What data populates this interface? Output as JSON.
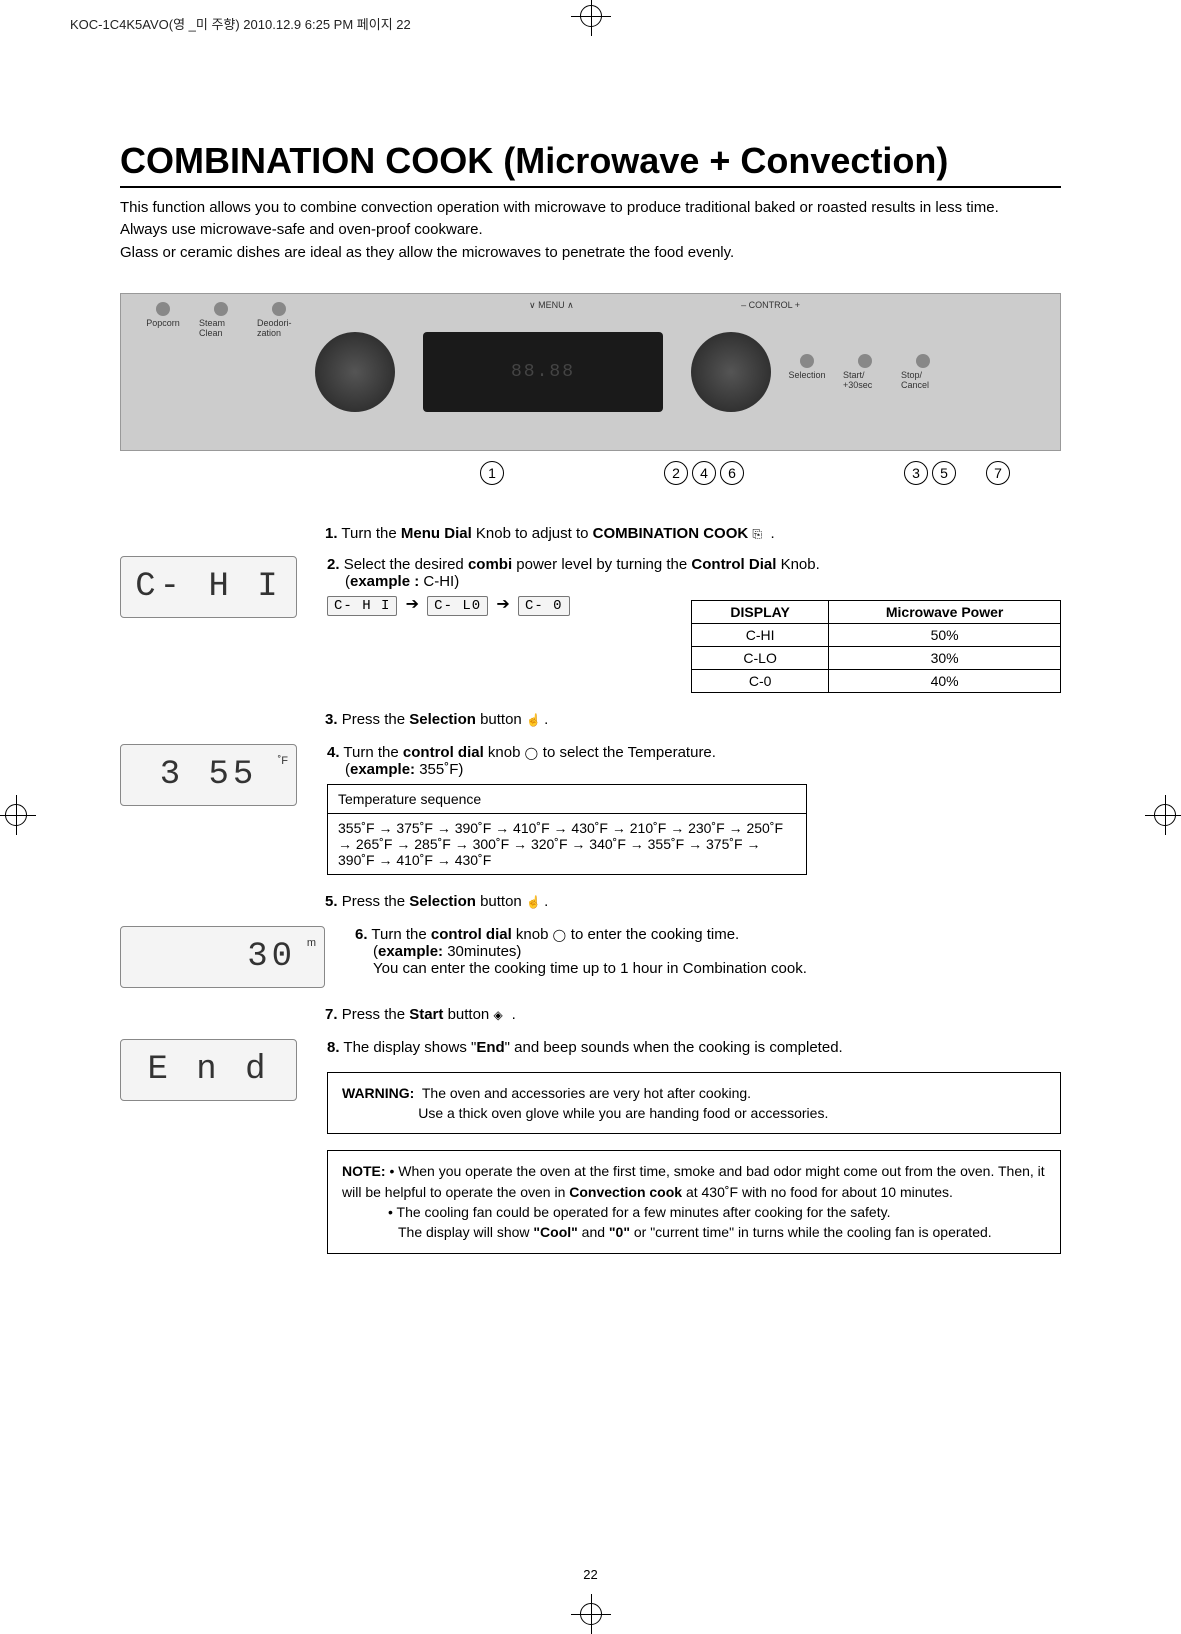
{
  "print_header": "KOC-1C4K5AVO(영 _미 주향) 2010.12.9 6:25 PM 페이지 22",
  "title": "COMBINATION COOK (Microwave + Convection)",
  "intro": [
    "This function allows you to combine convection operation with microwave to produce traditional baked or roasted results in less time.",
    "Always use microwave-safe and oven-proof cookware.",
    "Glass or ceramic dishes are ideal as they allow the microwaves to penetrate the food evenly."
  ],
  "panel": {
    "buttons_left": [
      "Popcorn",
      "Steam\nClean",
      "Deodori-\nzation"
    ],
    "menu_chevrons": "∨ MENU ∧",
    "display_digits": "88.88",
    "control_chevrons": "– CONTROL +",
    "buttons_right": [
      "Selection",
      "Start/\n+30sec",
      "Stop/\nCancel"
    ]
  },
  "step_circle_groups": [
    [
      "1"
    ],
    [
      "2",
      "4",
      "6"
    ],
    [
      "3",
      "5"
    ],
    [
      "7"
    ]
  ],
  "displays": {
    "d1": "C- H I",
    "d2": "3 55",
    "d2_unit": "˚F",
    "d3": "30",
    "d3_unit": "m",
    "d4": "E n d"
  },
  "small_displays": [
    "C- H I",
    "C- L0",
    "C- 0"
  ],
  "steps": {
    "s1_pre": "Turn the ",
    "s1_bold1": "Menu Dial",
    "s1_mid": " Knob to adjust to ",
    "s1_bold2": "COMBINATION COOK",
    "s1_icon_label": "combi-icon",
    "s2_a": "Select the desired ",
    "s2_b": "combi",
    "s2_c": " power level by turning the ",
    "s2_d": "Control Dial",
    "s2_e": " Knob.",
    "s2_example_label": "example :",
    "s2_example_val": " C-HI",
    "s3_a": "Press the ",
    "s3_b": "Selection",
    "s3_c": " button ",
    "s4_a": "Turn the ",
    "s4_b": "control dial",
    "s4_c": " knob ",
    "s4_d": " to select the Temperature.",
    "s4_example_label": "example:",
    "s4_example_val": " 355˚F",
    "s5_a": "Press the ",
    "s5_b": "Selection",
    "s5_c": " button ",
    "s6_a": "Turn the ",
    "s6_b": "control dial",
    "s6_c": " knob ",
    "s6_d": " to enter the cooking time.",
    "s6_example_label": "example:",
    "s6_example_val": " 30minutes",
    "s6_note": "You can enter the cooking time up to 1 hour in Combination cook.",
    "s7_a": "Press the ",
    "s7_b": "Start",
    "s7_c": " button ",
    "s8_a": "The display shows \"",
    "s8_b": "End",
    "s8_c": "\" and beep sounds when the cooking is completed."
  },
  "power_table": {
    "headers": [
      "DISPLAY",
      "Microwave Power"
    ],
    "rows": [
      [
        "C-HI",
        "50%"
      ],
      [
        "C-LO",
        "30%"
      ],
      [
        "C-0",
        "40%"
      ]
    ]
  },
  "temp_seq": {
    "header": "Temperature sequence",
    "body": "355˚F → 375˚F → 390˚F → 410˚F → 430˚F → 210˚F → 230˚F → 250˚F → 265˚F → 285˚F → 300˚F → 320˚F → 340˚F → 355˚F → 375˚F → 390˚F → 410˚F → 430˚F"
  },
  "warning": {
    "label": "WARNING:",
    "l1": "The oven and accessories are very hot after cooking.",
    "l2": "Use a thick oven glove while you are handing food or accessories."
  },
  "note": {
    "label": "NOTE:",
    "p1a": "• When you operate the oven at the first time,  smoke and bad odor might come out from the oven. Then, it will be helpful to operate the oven in ",
    "p1b": "Convection cook",
    "p1c": " at 430˚F with no food for about 10 minutes.",
    "p2a": "• The cooling fan could be operated for a few minutes after cooking for the safety.",
    "p2b_pre": "The display will show ",
    "p2b_b1": "\"Cool\"",
    "p2b_mid": " and ",
    "p2b_b2": "\"0\"",
    "p2b_post": " or \"current time\" in turns while the cooling fan is operated."
  },
  "page_number": "22"
}
